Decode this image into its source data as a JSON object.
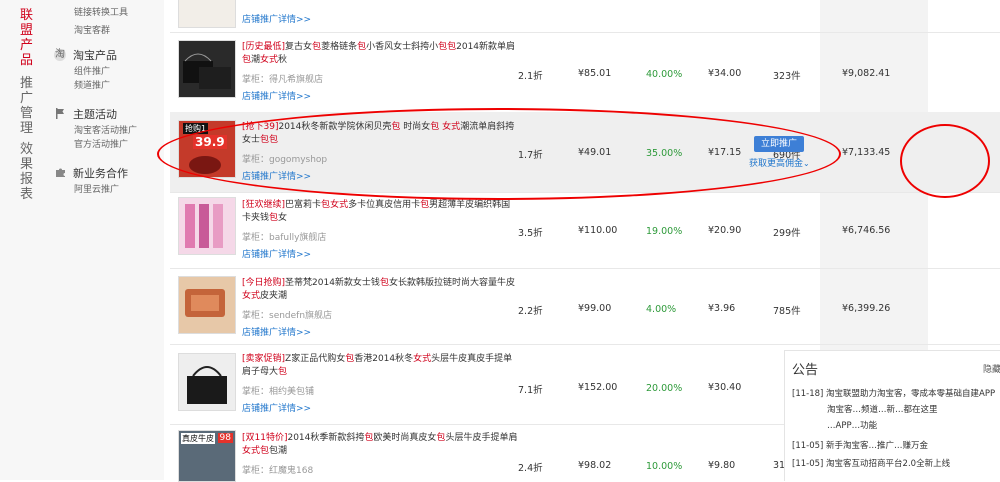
{
  "leftnav": {
    "categories": [
      {
        "label": "联盟产品",
        "active": true
      },
      {
        "label": "推广管理",
        "active": false
      },
      {
        "label": "效果报表",
        "active": false
      }
    ]
  },
  "subnav": {
    "top_items": [
      "链接转换工具",
      "淘宝客群"
    ],
    "groups": [
      {
        "title": "淘宝产品",
        "icon": "taobao-icon",
        "items": [
          "组件推广",
          "频道推广"
        ]
      },
      {
        "title": "主题活动",
        "icon": "flag-icon",
        "items": [
          "淘宝客活动推广",
          "官方活动推广"
        ]
      },
      {
        "title": "新业务合作",
        "icon": "puzzle-icon",
        "items": [
          "阿里云推广"
        ]
      }
    ]
  },
  "products": [
    {
      "tag": "",
      "title_parts": [],
      "shop": "",
      "promo_link": "店铺推广详情>>",
      "discount": "",
      "price": "",
      "rate": "",
      "commission": "",
      "sales": "",
      "total": ""
    },
    {
      "tag": "[历史最低]",
      "title_parts": [
        {
          "t": "复古女"
        },
        {
          "t": "包",
          "kw": true
        },
        {
          "t": "菱格链条"
        },
        {
          "t": "包",
          "kw": true
        },
        {
          "t": "小香风女士斜挎小"
        },
        {
          "t": "包包",
          "kw": true
        },
        {
          "t": "2014新款单肩"
        },
        {
          "t": "包",
          "kw": true
        },
        {
          "t": "潮"
        },
        {
          "t": "女式",
          "kw": true
        },
        {
          "t": "秋"
        }
      ],
      "shop": "掌柜：得凡希旗舰店",
      "promo_link": "店铺推广详情>>",
      "discount": "2.1折",
      "price": "¥85.01",
      "rate": "40.00%",
      "commission": "¥34.00",
      "sales": "323件",
      "total": "¥9,082.41"
    },
    {
      "tag": "[抢下39]",
      "title_parts": [
        {
          "t": "2014秋冬新款学院休闲贝壳"
        },
        {
          "t": "包",
          "kw": true
        },
        {
          "t": " 时尚女"
        },
        {
          "t": "包",
          "kw": true
        },
        {
          "t": " "
        },
        {
          "t": "女式",
          "kw": true
        },
        {
          "t": "潮流单肩斜挎女士"
        },
        {
          "t": "包包",
          "kw": true
        }
      ],
      "shop": "掌柜：gogomyshop",
      "promo_link": "店铺推广详情>>",
      "discount": "1.7折",
      "price": "¥49.01",
      "rate": "35.00%",
      "commission": "¥17.15",
      "sales": "690件",
      "total": "¥7,133.45",
      "thumb_text": "抢购1",
      "thumb_price": "39.9"
    },
    {
      "tag": "[狂欢继续]",
      "title_parts": [
        {
          "t": "巴富莉卡"
        },
        {
          "t": "包",
          "kw": true
        },
        {
          "t": "女式",
          "kw": true
        },
        {
          "t": "多卡位真皮信用卡"
        },
        {
          "t": "包",
          "kw": true
        },
        {
          "t": "男超薄羊皮编织韩国卡夹钱"
        },
        {
          "t": "包",
          "kw": true
        },
        {
          "t": "女"
        }
      ],
      "shop": "掌柜：bafully旗舰店",
      "promo_link": "店铺推广详情>>",
      "discount": "3.5折",
      "price": "¥110.00",
      "rate": "19.00%",
      "commission": "¥20.90",
      "sales": "299件",
      "total": "¥6,746.56"
    },
    {
      "tag": "[今日抢购]",
      "title_parts": [
        {
          "t": "圣蒂梵2014新款女士钱"
        },
        {
          "t": "包",
          "kw": true
        },
        {
          "t": "女长款韩版拉链时尚大容量牛皮"
        },
        {
          "t": "女式",
          "kw": true
        },
        {
          "t": "皮夹潮"
        }
      ],
      "shop": "掌柜：sendefn旗舰店",
      "promo_link": "店铺推广详情>>",
      "discount": "2.2折",
      "price": "¥99.00",
      "rate": "4.00%",
      "commission": "¥3.96",
      "sales": "785件",
      "total": "¥6,399.26"
    },
    {
      "tag": "[卖家促销]",
      "title_parts": [
        {
          "t": "Z家正品代购女"
        },
        {
          "t": "包",
          "kw": true
        },
        {
          "t": "香港2014秋冬"
        },
        {
          "t": "女式",
          "kw": true
        },
        {
          "t": "头层牛皮真皮手提单肩子母大"
        },
        {
          "t": "包",
          "kw": true
        }
      ],
      "shop": "掌柜：相约美包铺",
      "promo_link": "店铺推广详情>>",
      "discount": "7.1折",
      "price": "¥152.00",
      "rate": "20.00%",
      "commission": "¥30.40",
      "sales": "",
      "total": ""
    },
    {
      "tag": "[双11特价]",
      "title_parts": [
        {
          "t": "2014秋季新款斜挎"
        },
        {
          "t": "包",
          "kw": true
        },
        {
          "t": "欧美时尚真皮女"
        },
        {
          "t": "包",
          "kw": true
        },
        {
          "t": "头层牛皮手提单肩"
        },
        {
          "t": "女式",
          "kw": true
        },
        {
          "t": "包",
          "kw": true
        },
        {
          "t": "包潮"
        }
      ],
      "shop": "掌柜：红魔鬼168",
      "promo_link": "",
      "discount": "2.4折",
      "price": "¥98.02",
      "rate": "10.00%",
      "commission": "¥9.80",
      "sales": "31",
      "total": "",
      "thumb_text": "真皮牛皮",
      "thumb_price": "98"
    }
  ],
  "actions": {
    "promote_button": "立即推广",
    "more_commission_link": "获取更高佣金"
  },
  "notice": {
    "title": "公告",
    "hide": "隐藏",
    "items": [
      {
        "date": "[11-18]",
        "text": "淘宝联盟助力淘宝客，零成本零基础自建APP"
      },
      {
        "date": "",
        "text": "淘宝客…频道…新…都在这里"
      },
      {
        "date": "",
        "text": "…APP…功能"
      },
      {
        "date": "[11-05]",
        "text": "新手淘宝客…推广…赚万金"
      },
      {
        "date": "[11-05]",
        "text": "淘宝客互动招商平台2.0全新上线"
      }
    ]
  },
  "colors": {
    "accent": "#d0011b",
    "link": "#2277cc",
    "rate": "#2e9a3a",
    "annotation": "#e00000",
    "button": "#3d7fd6"
  }
}
